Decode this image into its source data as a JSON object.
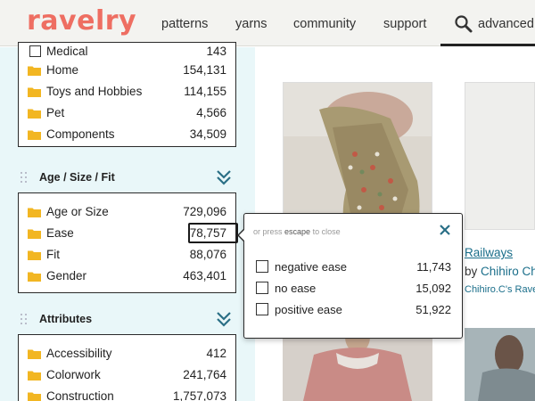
{
  "brand": {
    "logo": "ravelry",
    "accent": "#ee6e62"
  },
  "nav": {
    "items": [
      "patterns",
      "yarns",
      "community",
      "support"
    ],
    "search_label": "advanced s"
  },
  "sidebar": {
    "categories_box": {
      "rows": [
        {
          "label": "Medical",
          "count": "143"
        },
        {
          "label": "Home",
          "count": "154,131"
        },
        {
          "label": "Toys and Hobbies",
          "count": "114,155"
        },
        {
          "label": "Pet",
          "count": "4,566"
        },
        {
          "label": "Components",
          "count": "34,509"
        }
      ]
    },
    "age_section": {
      "title": "Age / Size / Fit",
      "rows": [
        {
          "label": "Age or Size",
          "count": "729,096"
        },
        {
          "label": "Ease",
          "count": "78,757"
        },
        {
          "label": "Fit",
          "count": "88,076"
        },
        {
          "label": "Gender",
          "count": "463,401"
        }
      ]
    },
    "attributes_section": {
      "title": "Attributes",
      "rows": [
        {
          "label": "Accessibility",
          "count": "412"
        },
        {
          "label": "Colorwork",
          "count": "241,764"
        },
        {
          "label": "Construction",
          "count": "1,757,073"
        }
      ]
    }
  },
  "popup": {
    "hint_prefix": "or press",
    "hint_key": "escape",
    "hint_suffix": "to close",
    "options": [
      {
        "label": "negative ease",
        "count": "11,743",
        "checked": false
      },
      {
        "label": "no ease",
        "count": "15,092",
        "checked": false
      },
      {
        "label": "positive ease",
        "count": "51,922",
        "checked": false
      }
    ]
  },
  "pattern_card": {
    "title": "Railways",
    "by_prefix": "by",
    "designer": "Chihiro Ch",
    "source": "Chihiro.C's Rave"
  },
  "colors": {
    "sidebar_bg": "#e9f7f9",
    "link": "#1a6e8a",
    "chevron": "#2a6f86",
    "folder": "#f2b622"
  }
}
